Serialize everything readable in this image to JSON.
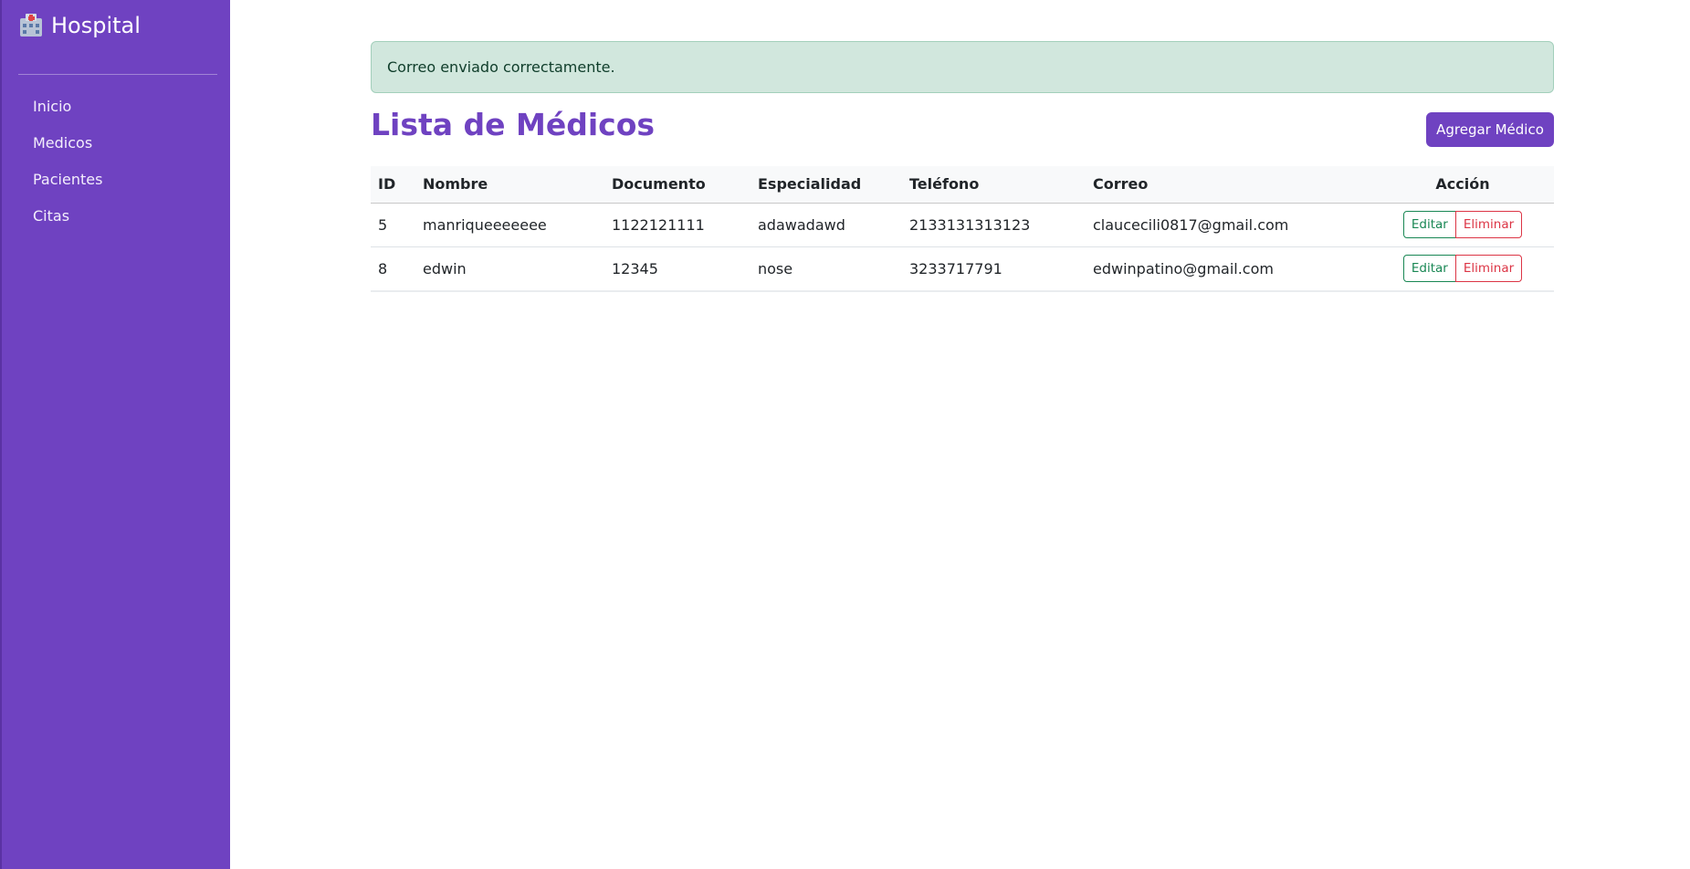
{
  "sidebar": {
    "brand": "Hospital",
    "brand_icon": "hospital-icon",
    "items": [
      {
        "label": "Inicio"
      },
      {
        "label": "Medicos"
      },
      {
        "label": "Pacientes"
      },
      {
        "label": "Citas"
      }
    ],
    "color": "#6f42c1"
  },
  "alert": {
    "message": "Correo enviado correctamente.",
    "color": "#d1e7dd"
  },
  "main": {
    "title": "Lista de Médicos",
    "add_label": "Agregar Médico",
    "accent": "#6f42c1"
  },
  "table": {
    "headers": {
      "id": "ID",
      "name": "Nombre",
      "document": "Documento",
      "specialty": "Especialidad",
      "phone": "Teléfono",
      "email": "Correo",
      "action": "Acción"
    },
    "edit_label": "Editar",
    "delete_label": "Eliminar",
    "rows": [
      {
        "id": "5",
        "name": "manriqueeeeeee",
        "document": "1122121111",
        "specialty": "adawadawd",
        "phone": "2133131313123",
        "email": "claucecili0817@gmail.com"
      },
      {
        "id": "8",
        "name": "edwin",
        "document": "12345",
        "specialty": "nose",
        "phone": "3233717791",
        "email": "edwinpatino@gmail.com"
      }
    ]
  }
}
